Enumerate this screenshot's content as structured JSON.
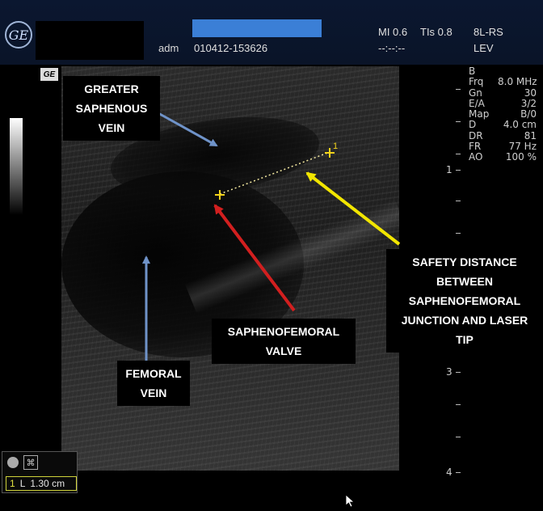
{
  "header": {
    "logo_text": "GE",
    "operator": "adm",
    "exam_id": "010412-153626",
    "mi": "MI 0.6",
    "tis": "TIs 0.8",
    "probe": "8L-RS",
    "time": "--:--:--",
    "preset": "LEV"
  },
  "image": {
    "corner_mark": "GE"
  },
  "params": {
    "mode": "B",
    "rows": [
      {
        "key": "Frq",
        "value": "8.0 MHz"
      },
      {
        "key": "Gn",
        "value": "30"
      },
      {
        "key": "E/A",
        "value": "3/2"
      },
      {
        "key": "Map",
        "value": "B/0"
      },
      {
        "key": "D",
        "value": "4.0 cm"
      },
      {
        "key": "DR",
        "value": "81"
      },
      {
        "key": "FR",
        "value": "77 Hz"
      },
      {
        "key": "AO",
        "value": "100 %"
      }
    ]
  },
  "depth_scale": {
    "labels": [
      "1",
      "3",
      "4"
    ]
  },
  "annotations": {
    "greater_saphenous_vein": "GREATER SAPHENOUS VEIN",
    "femoral_vein": "FEMORAL VEIN",
    "saphenofemoral_valve": "SAPHENOFEMORAL VALVE",
    "safety_distance": "SAFETY DISTANCE BETWEEN SAPHENOFEMORAL JUNCTION AND LASER TIP"
  },
  "caliper": {
    "marker_end_label": "1"
  },
  "measurement": {
    "index": "1",
    "type": "L",
    "value": "1.30 cm"
  },
  "colors": {
    "arrow_blue": "#6f93c9",
    "arrow_red": "#d21f1f",
    "arrow_yellow": "#f2e600",
    "header_blue_bar": "#3b7fd6"
  }
}
